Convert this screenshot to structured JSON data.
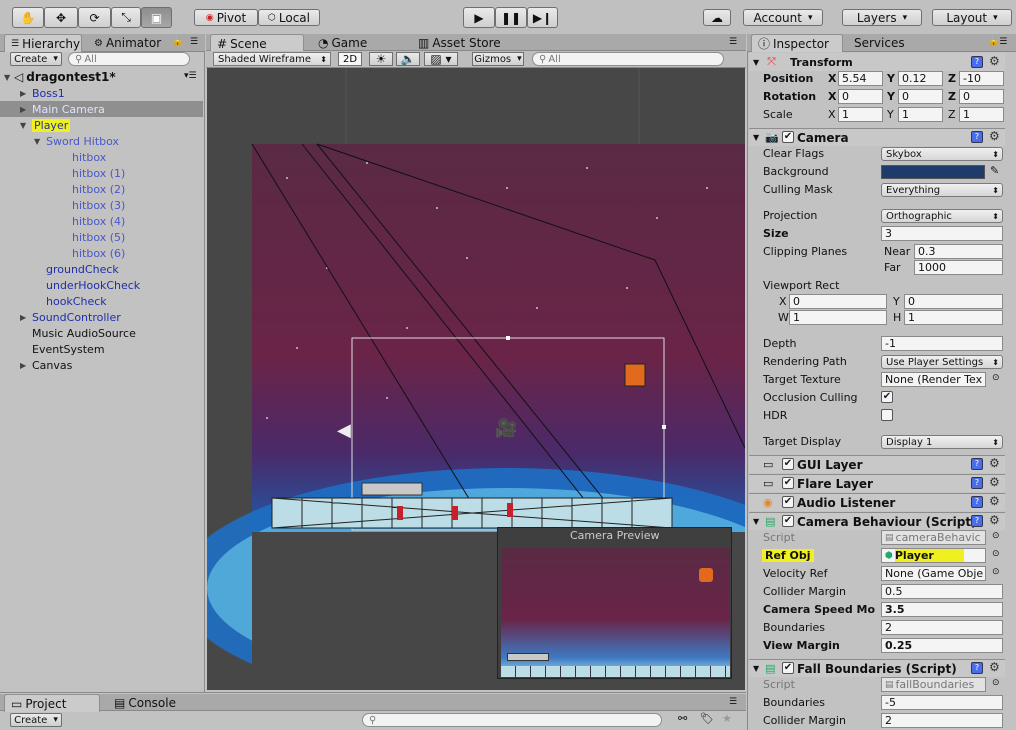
{
  "toolbar": {
    "tools": [
      "hand-icon",
      "move-icon",
      "rotate-icon",
      "scale-icon",
      "rect-icon"
    ],
    "pivot": "Pivot",
    "local": "Local",
    "account": "Account",
    "layers": "Layers",
    "layout": "Layout"
  },
  "hierarchy": {
    "tab": "Hierarchy",
    "tab2": "Animator",
    "create": "Create",
    "search_placeholder": "All",
    "scene_name": "dragontest1*",
    "items": [
      {
        "label": "Boss1",
        "expand": "▶"
      },
      {
        "label": "Main Camera",
        "expand": "▶"
      },
      {
        "label": "Player",
        "expand": "▼"
      },
      {
        "label": "Sword Hitbox",
        "expand": "▼"
      },
      {
        "label": "hitbox"
      },
      {
        "label": "hitbox (1)"
      },
      {
        "label": "hitbox (2)"
      },
      {
        "label": "hitbox (3)"
      },
      {
        "label": "hitbox (4)"
      },
      {
        "label": "hitbox (5)"
      },
      {
        "label": "hitbox (6)"
      },
      {
        "label": "groundCheck"
      },
      {
        "label": "underHookCheck"
      },
      {
        "label": "hookCheck"
      },
      {
        "label": "SoundController",
        "expand": "▶"
      },
      {
        "label": "Music AudioSource"
      },
      {
        "label": "EventSystem"
      },
      {
        "label": "Canvas",
        "expand": "▶"
      }
    ]
  },
  "scene": {
    "tabs": [
      "Scene",
      "Game",
      "Asset Store"
    ],
    "shading": "Shaded Wireframe",
    "mode2d": "2D",
    "gizmos": "Gizmos",
    "search_placeholder": "All",
    "camera_preview_title": "Camera Preview"
  },
  "inspector": {
    "tab": "Inspector",
    "tab2": "Services",
    "transform": {
      "title": "Transform",
      "position_label": "Position",
      "px": "5.54",
      "py": "0.12",
      "pz": "-10",
      "rotation_label": "Rotation",
      "rx": "0",
      "ry": "0",
      "rz": "0",
      "scale_label": "Scale",
      "sx": "1",
      "sy": "1",
      "sz": "1"
    },
    "camera": {
      "title": "Camera",
      "clear_flags_label": "Clear Flags",
      "clear_flags": "Skybox",
      "background_label": "Background",
      "culling_mask_label": "Culling Mask",
      "culling_mask": "Everything",
      "projection_label": "Projection",
      "projection": "Orthographic",
      "size_label": "Size",
      "size": "3",
      "clipping_label": "Clipping Planes",
      "near_label": "Near",
      "near": "0.3",
      "far_label": "Far",
      "far": "1000",
      "viewport_label": "Viewport Rect",
      "vx": "0",
      "vy": "0",
      "vw": "1",
      "vh": "1",
      "depth_label": "Depth",
      "depth": "-1",
      "rendering_label": "Rendering Path",
      "rendering": "Use Player Settings",
      "target_texture_label": "Target Texture",
      "target_texture": "None (Render Tex",
      "occlusion_label": "Occlusion Culling",
      "hdr_label": "HDR",
      "target_display_label": "Target Display",
      "target_display": "Display 1"
    },
    "gui_layer": "GUI Layer",
    "flare_layer": "Flare Layer",
    "audio_listener": "Audio Listener",
    "camera_behaviour": {
      "title": "Camera Behaviour (Script)",
      "script_label": "Script",
      "script": "cameraBehavic",
      "ref_obj_label": "Ref Obj",
      "ref_obj": "Player",
      "velocity_ref_label": "Velocity Ref",
      "velocity_ref": "None (Game Obje",
      "collider_margin_label": "Collider Margin",
      "collider_margin": "0.5",
      "speed_label": "Camera Speed Mo",
      "speed": "3.5",
      "boundaries_label": "Boundaries",
      "boundaries": "2",
      "view_margin_label": "View Margin",
      "view_margin": "0.25"
    },
    "fall_boundaries": {
      "title": "Fall Boundaries (Script)",
      "script_label": "Script",
      "script": "fallBoundaries",
      "boundaries_label": "Boundaries",
      "boundaries": "-5",
      "collider_margin_label": "Collider Margin",
      "collider_margin": "2"
    }
  },
  "bottom": {
    "project_tab": "Project",
    "console_tab": "Console",
    "create": "Create"
  },
  "colors": {
    "camera_background": "#1f3b6b",
    "highlight": "#f0f020"
  }
}
